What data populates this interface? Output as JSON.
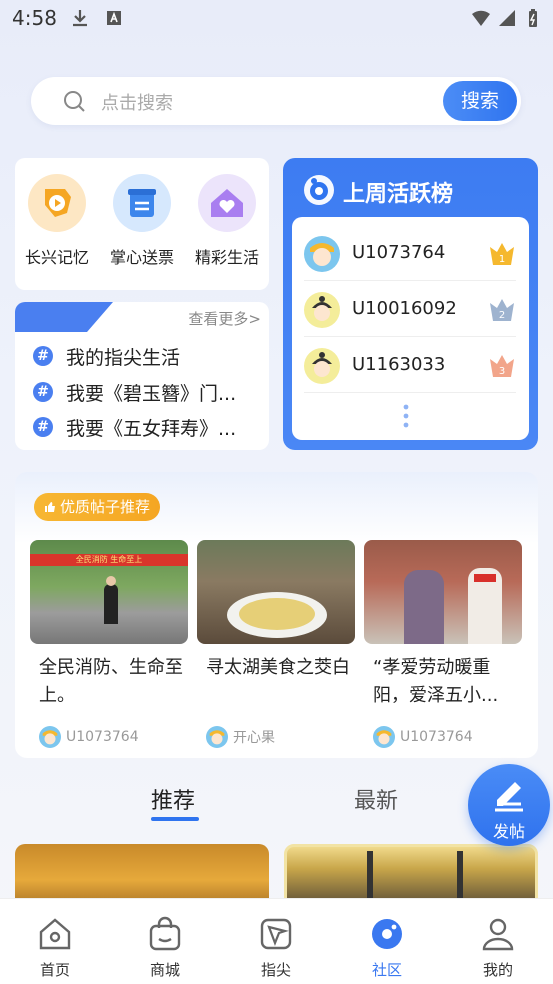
{
  "status_bar": {
    "time": "4:58"
  },
  "search": {
    "placeholder": "点击搜索",
    "button_label": "搜索"
  },
  "shortcuts": [
    {
      "label": "长兴记忆",
      "icon": "play-map-icon"
    },
    {
      "label": "掌心送票",
      "icon": "ticket-icon"
    },
    {
      "label": "精彩生活",
      "icon": "heart-house-icon"
    }
  ],
  "topics": {
    "more_label": "查看更多>",
    "items": [
      "我的指尖生活",
      "我要《碧玉簪》门...",
      "我要《五女拜寿》..."
    ]
  },
  "leaderboard": {
    "title": "上周活跃榜",
    "entries": [
      {
        "name": "U1073764",
        "rank": "1"
      },
      {
        "name": "U10016092",
        "rank": "2"
      },
      {
        "name": "U1163033",
        "rank": "3"
      }
    ]
  },
  "featured": {
    "tag_label": "优质帖子推荐",
    "posts": [
      {
        "title": "全民消防、生命至上。",
        "author": "U1073764",
        "banner_text": "全民消防 生命至上"
      },
      {
        "title": "寻太湖美食之茭白",
        "author": "开心果"
      },
      {
        "title": "“孝爱劳动暖重阳，爱泽五小...",
        "author": "U1073764"
      }
    ]
  },
  "feed_tabs": {
    "recommend": "推荐",
    "latest": "最新"
  },
  "fab": {
    "label": "发帖"
  },
  "bottom_nav": [
    {
      "label": "首页",
      "icon": "home-icon"
    },
    {
      "label": "商城",
      "icon": "shopping-bag-icon"
    },
    {
      "label": "指尖",
      "icon": "fingertip-icon"
    },
    {
      "label": "社区",
      "icon": "community-icon",
      "active": true
    },
    {
      "label": "我的",
      "icon": "profile-icon"
    }
  ],
  "colors": {
    "accent": "#2f74ef",
    "tag": "#f5a623"
  }
}
